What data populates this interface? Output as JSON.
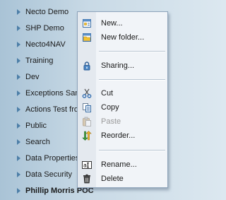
{
  "tree": {
    "items": [
      {
        "label": "Necto Demo"
      },
      {
        "label": "SHP Demo"
      },
      {
        "label": "Necto4NAV"
      },
      {
        "label": "Training"
      },
      {
        "label": "Dev"
      },
      {
        "label": "Exceptions San"
      },
      {
        "label": "Actions Test fro"
      },
      {
        "label": "Public"
      },
      {
        "label": "Search"
      },
      {
        "label": "Data Properties"
      },
      {
        "label": "Data Security"
      },
      {
        "label": "Phillip Morris POC"
      }
    ]
  },
  "context_menu": {
    "items": [
      {
        "label": "New...",
        "icon": "new-item-icon",
        "enabled": true
      },
      {
        "label": "New folder...",
        "icon": "new-folder-icon",
        "enabled": true
      },
      {
        "label": "Sharing...",
        "icon": "sharing-lock-icon",
        "enabled": true
      },
      {
        "label": "Cut",
        "icon": "scissors-icon",
        "enabled": true
      },
      {
        "label": "Copy",
        "icon": "copy-icon",
        "enabled": true
      },
      {
        "label": "Paste",
        "icon": "paste-icon",
        "enabled": false
      },
      {
        "label": "Reorder...",
        "icon": "reorder-icon",
        "enabled": true
      },
      {
        "label": "Rename...",
        "icon": "rename-icon",
        "enabled": true
      },
      {
        "label": "Delete",
        "icon": "trash-icon",
        "enabled": true
      }
    ]
  },
  "colors": {
    "tree_arrow": "#4d7fa8",
    "menu_background": "#f1f4f8",
    "menu_border": "#8ea4bb",
    "disabled_text": "#9a9a9a"
  }
}
